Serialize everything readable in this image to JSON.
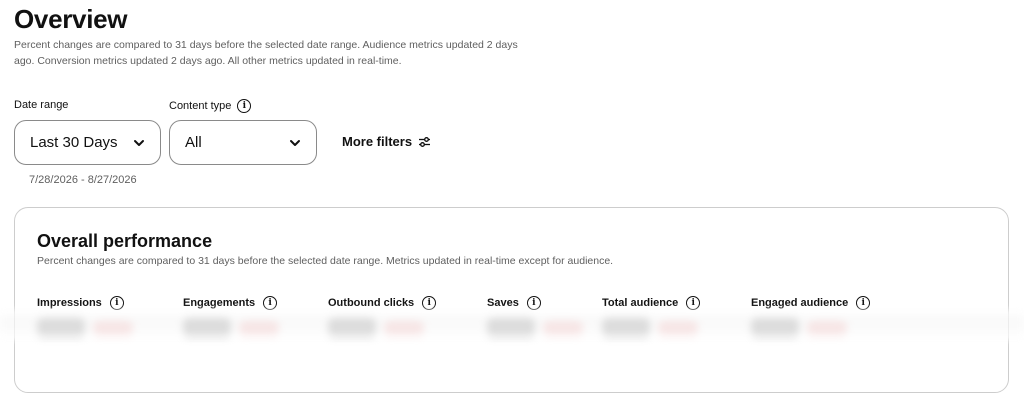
{
  "header": {
    "title": "Overview",
    "subtitle": "Percent changes are compared to 31 days before the selected date range. Audience metrics updated 2 days ago. Conversion metrics updated 2 days ago. All other metrics updated in real-time."
  },
  "filters": {
    "date_range": {
      "label": "Date range",
      "value": "Last 30 Days",
      "span": "7/28/2026 - 8/27/2026"
    },
    "content_type": {
      "label": "Content type",
      "value": "All"
    },
    "more_filters_label": "More filters"
  },
  "performance": {
    "title": "Overall performance",
    "subtitle": "Percent changes are compared to 31 days before the selected date range. Metrics updated in real-time except for audience.",
    "metrics": [
      {
        "label": "Impressions"
      },
      {
        "label": "Engagements"
      },
      {
        "label": "Outbound clicks"
      },
      {
        "label": "Saves"
      },
      {
        "label": "Total audience"
      },
      {
        "label": "Engaged audience"
      }
    ]
  },
  "icons": {
    "info": "info-icon",
    "chevron": "chevron-down-icon",
    "filters": "sliders-icon"
  },
  "colors": {
    "text": "#111111",
    "muted": "#5f5f5f",
    "border": "#8a8a8a",
    "card_border": "#cdcdcd",
    "redacted_change": "#f2b8b8"
  }
}
